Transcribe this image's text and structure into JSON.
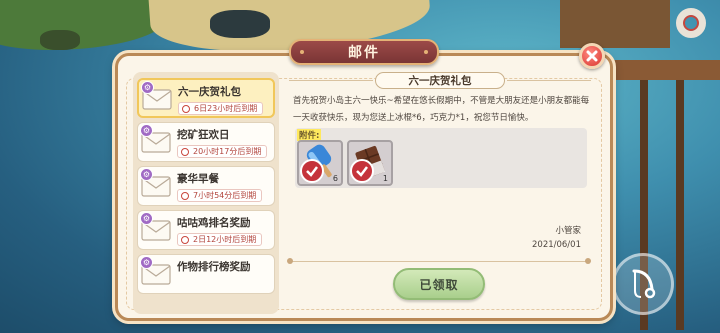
{
  "window": {
    "title": "邮件"
  },
  "mails": [
    {
      "name": "六一庆贺礼包",
      "time": "6日23小时后到期",
      "selected": true
    },
    {
      "name": "挖矿狂欢日",
      "time": "20小时17分后到期",
      "selected": false
    },
    {
      "name": "豪华早餐",
      "time": "7小时54分后到期",
      "selected": false
    },
    {
      "name": "咕咕鸡排名奖励",
      "time": "2日12小时后到期",
      "selected": false
    },
    {
      "name": "作物排行榜奖励",
      "time": "",
      "selected": false
    }
  ],
  "content": {
    "title": "六一庆贺礼包",
    "body_line1": "首先祝贺小岛主六一快乐~希望在悠长假期中，不管是大朋友还是小朋友都能每",
    "body_line2": "一天收获快乐，现为您送上冰棍*6，巧克力*1，祝您节日愉快。",
    "rewards_label": "附件:",
    "rewards": [
      {
        "name": "popsicle-icon",
        "count": "6"
      },
      {
        "name": "chocolate-icon",
        "count": "1"
      }
    ],
    "sender": "小管家",
    "date": "2021/06/01",
    "claim_label": "已领取"
  },
  "colors": {
    "accent": "#9c4a48",
    "claim": "#a9cf8c",
    "close": "#d9362f"
  }
}
